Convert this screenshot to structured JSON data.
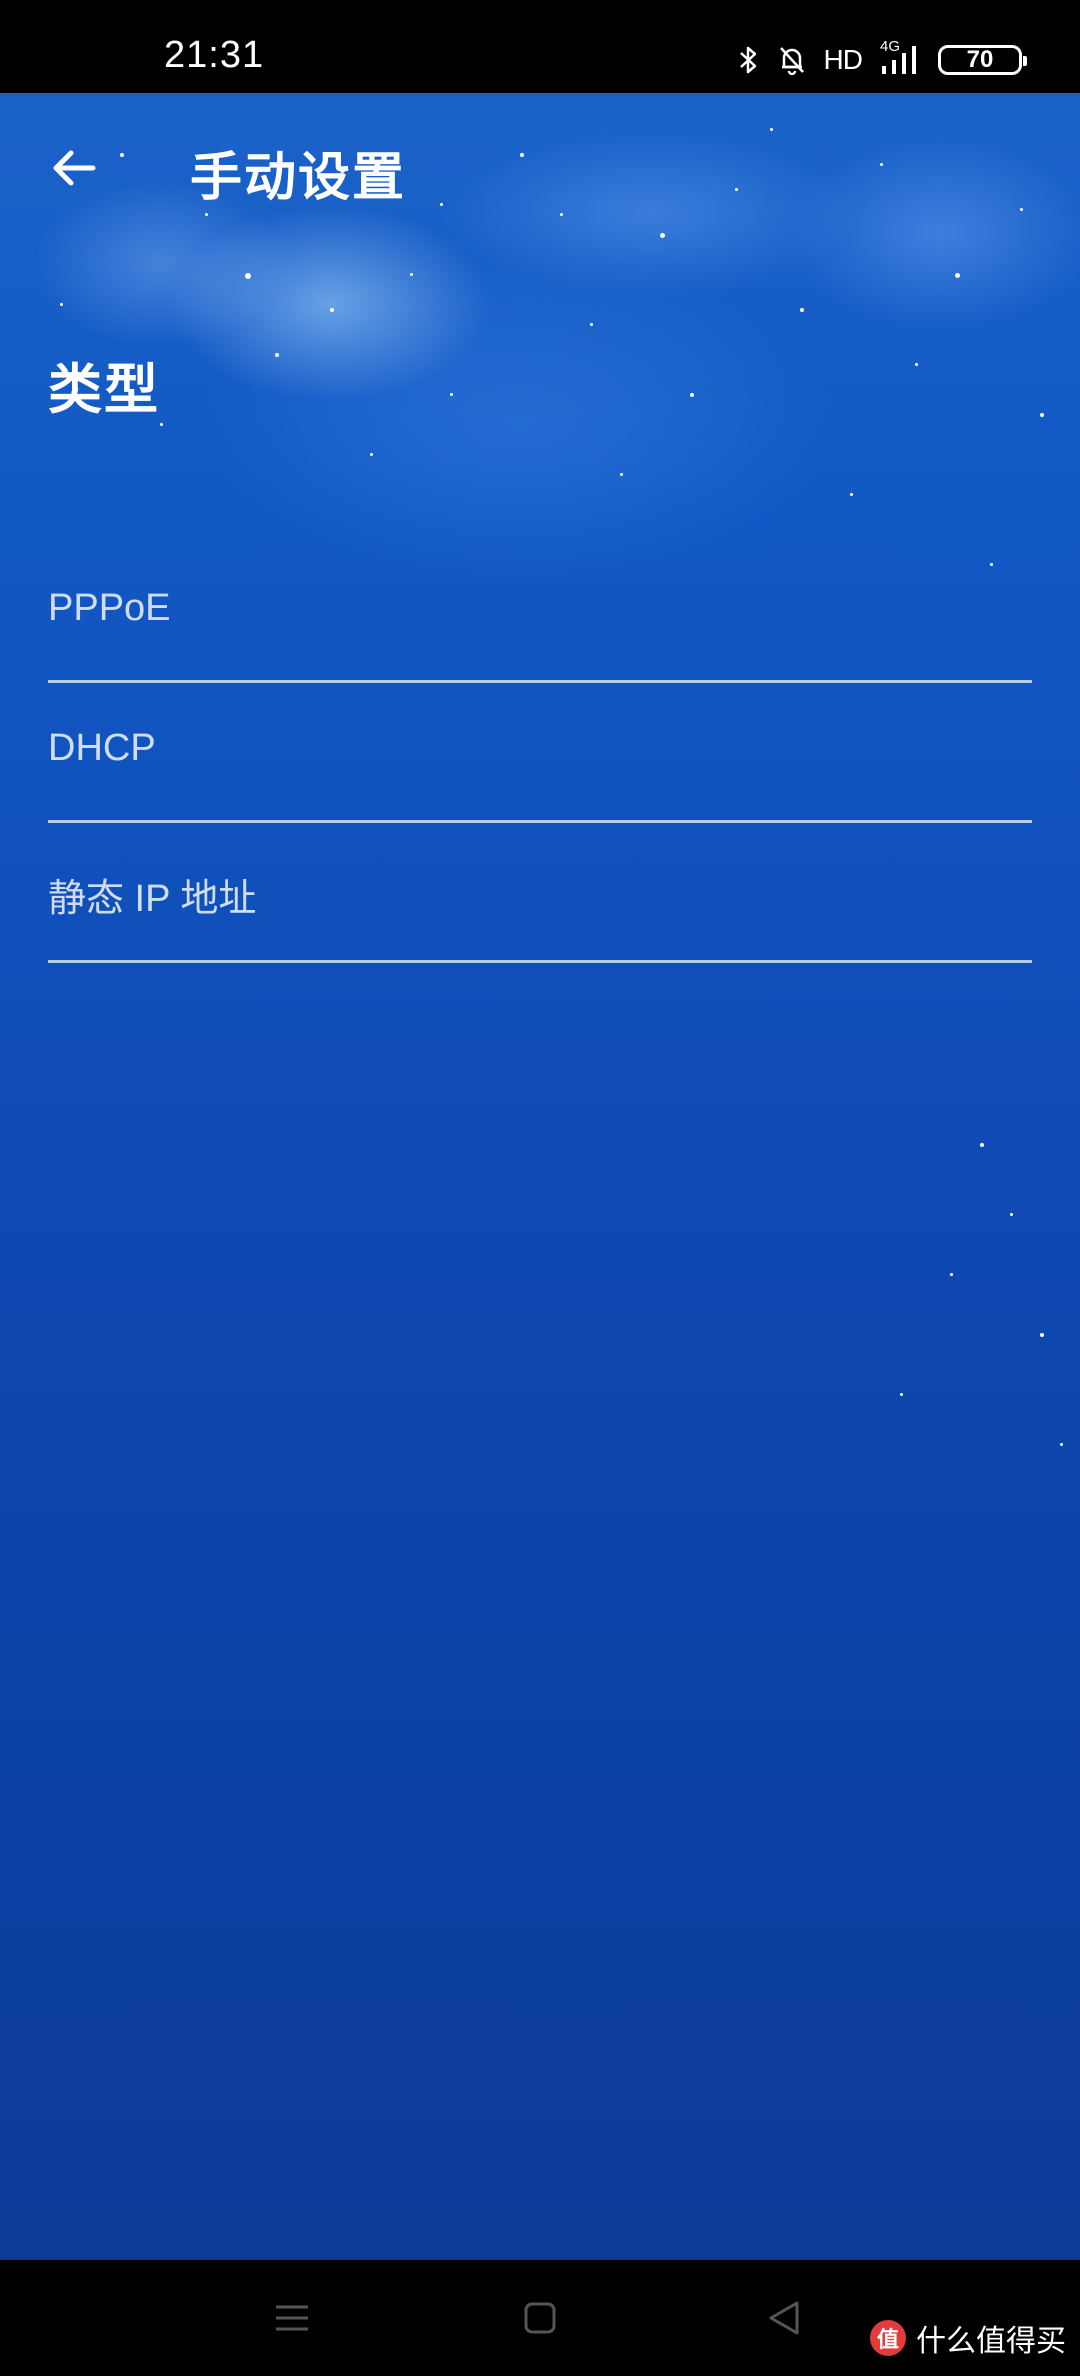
{
  "status_bar": {
    "time": "21:31",
    "icons": [
      "bluetooth-icon",
      "bell-off-icon",
      "hd-icon",
      "signal-4g-icon",
      "battery-icon"
    ],
    "hd_label": "HD",
    "network_label": "4G",
    "battery_level": "70"
  },
  "header": {
    "back_icon": "arrow-left-icon",
    "title": "手动设置"
  },
  "section": {
    "title": "类型"
  },
  "options": [
    {
      "label": "PPPoE"
    },
    {
      "label": "DHCP"
    },
    {
      "label": "静态 IP 地址"
    }
  ],
  "nav_bar": {
    "icons": [
      "menu-icon",
      "home-icon",
      "back-triangle-icon"
    ]
  },
  "watermark": {
    "text": "什么值得买",
    "logo_text": "值"
  },
  "colors": {
    "background_top": "#1b62c8",
    "background_bottom": "#0b3a98",
    "text_primary": "#ffffff",
    "divider": "#d7e1f0"
  }
}
